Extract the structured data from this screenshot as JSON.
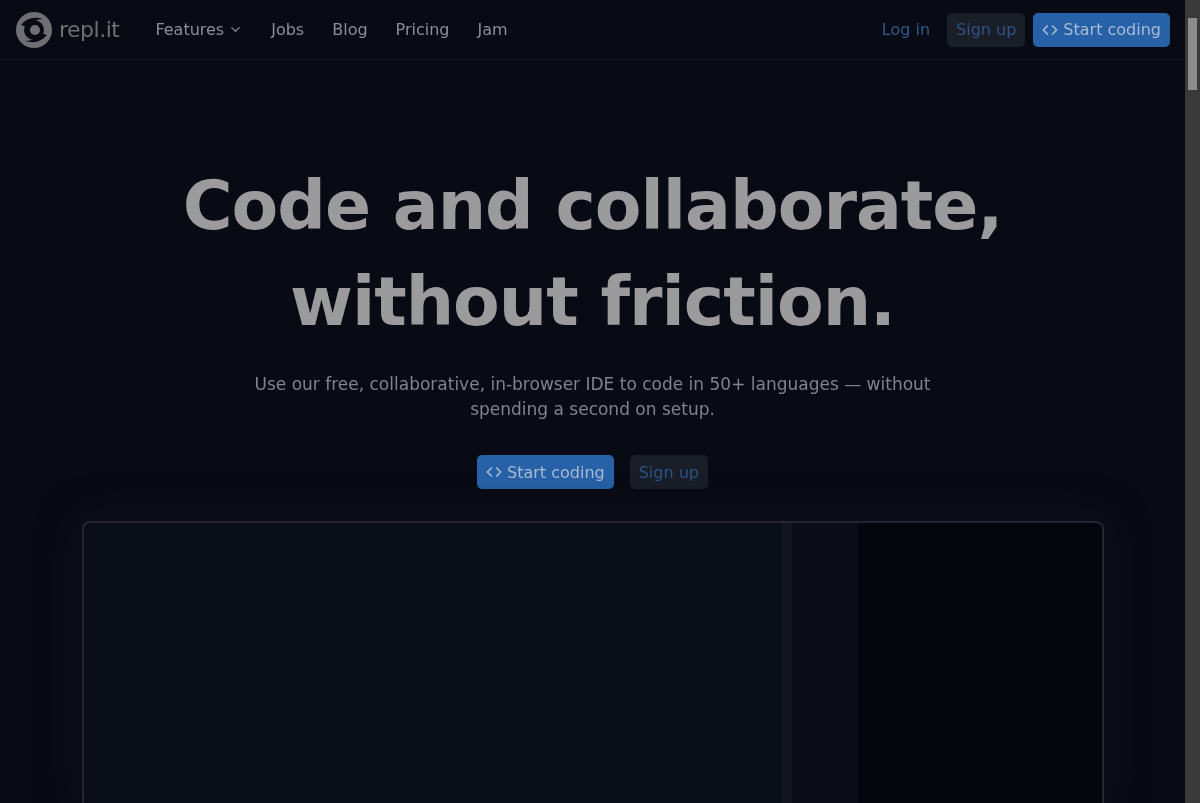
{
  "header": {
    "logo": "repl.it",
    "nav": [
      {
        "label": "Features",
        "kind": "dropdown"
      },
      {
        "label": "Jobs",
        "kind": "link"
      },
      {
        "label": "Blog",
        "kind": "link"
      },
      {
        "label": "Pricing",
        "kind": "link"
      },
      {
        "label": "Jam",
        "kind": "link"
      }
    ],
    "actions": [
      {
        "label": "Log in",
        "kind": "link"
      },
      {
        "label": "Sign up",
        "kind": "secondary"
      },
      {
        "label": "Start coding",
        "kind": "primary"
      }
    ]
  },
  "hero": {
    "title_lines": [
      "Code and collaborate,",
      "without friction."
    ],
    "subtitle": "Use our free, collaborative, in-browser IDE to code in 50+ languages — without spending a second on setup.",
    "buttons": [
      {
        "label": "Start coding",
        "kind": "primary"
      },
      {
        "label": "Sign up",
        "kind": "secondary"
      }
    ]
  }
}
